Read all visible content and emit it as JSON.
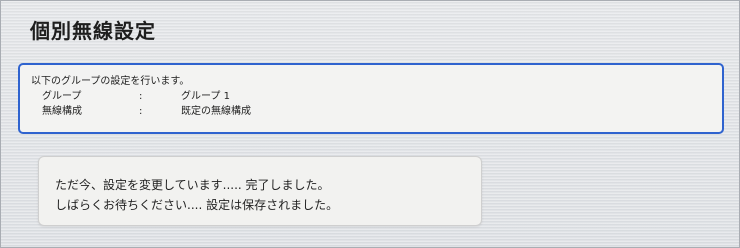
{
  "header": {
    "title": "個別無線設定"
  },
  "info": {
    "intro": "以下のグループの設定を行います。",
    "rows": [
      {
        "label": "グループ",
        "separator": ":",
        "value": "グループ 1"
      },
      {
        "label": "無線構成",
        "separator": ":",
        "value": "既定の無線構成"
      }
    ]
  },
  "status": {
    "line1": "ただ今、設定を変更しています..... 完了しました。",
    "line2": "しばらくお待ちください.... 設定は保存されました。"
  }
}
